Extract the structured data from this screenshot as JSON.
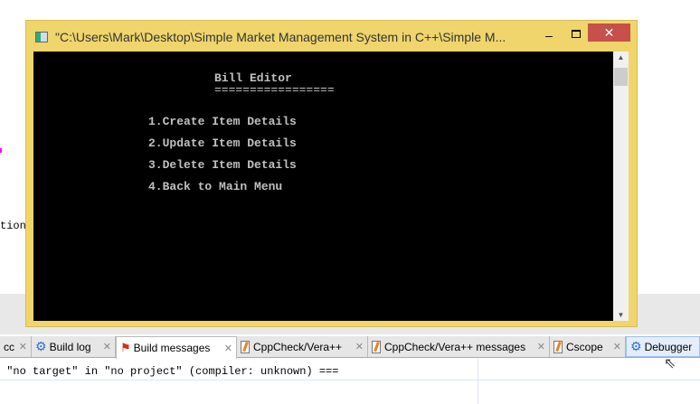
{
  "editor": {
    "partial_text": "tion"
  },
  "window": {
    "title": "\"C:\\Users\\Mark\\Desktop\\Simple Market Management System in C++\\Simple M...",
    "minimize": "‒",
    "close": "✕"
  },
  "console": {
    "heading": "Bill Editor",
    "underline": "=================",
    "items": [
      "1.Create Item Details",
      "2.Update Item Details",
      "3.Delete Item Details",
      "4.Back to Main Menu"
    ]
  },
  "tabs": [
    {
      "label": "cc"
    },
    {
      "label": "Build log"
    },
    {
      "label": "Build messages"
    },
    {
      "label": "CppCheck/Vera++"
    },
    {
      "label": "CppCheck/Vera++ messages"
    },
    {
      "label": "Cscope"
    },
    {
      "label": "Debugger"
    }
  ],
  "output": {
    "line1": " \"no target\" in \"no project\" (compiler: unknown) ==="
  }
}
